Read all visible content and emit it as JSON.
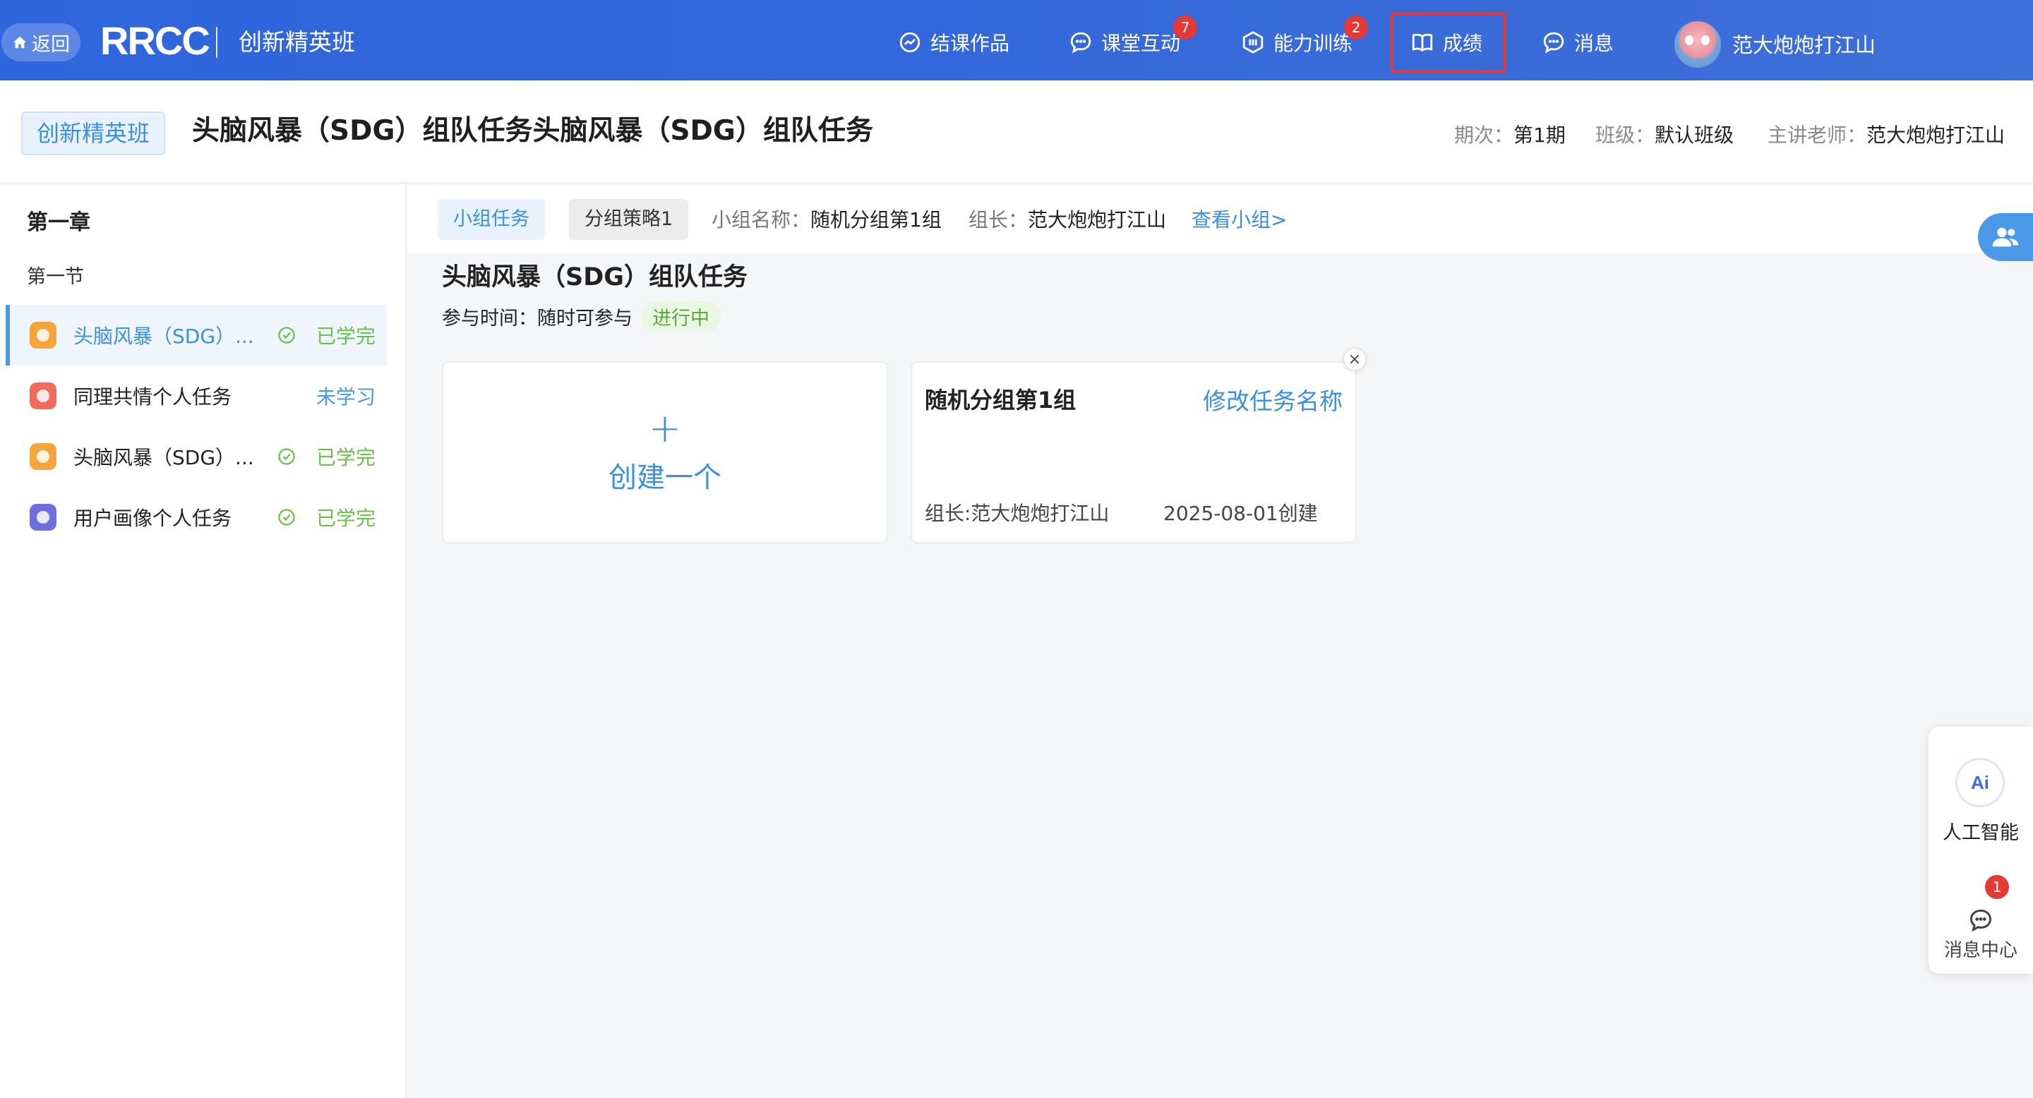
{
  "topbar": {
    "back_label": "返回",
    "logo": "RRCC",
    "brand": "创新精英班",
    "nav": [
      {
        "label": "结课作品",
        "icon": "chart-circle-icon"
      },
      {
        "label": "课堂互动",
        "icon": "chat-bubble-icon",
        "badge": "7"
      },
      {
        "label": "能力训练",
        "icon": "hexagon-icon",
        "badge": "2"
      },
      {
        "label": "成绩",
        "icon": "book-icon",
        "highlighted": true
      },
      {
        "label": "消息",
        "icon": "message-icon"
      }
    ],
    "user_name": "范大炮炮打江山",
    "highlight_color": "#e53935"
  },
  "header": {
    "class_tag": "创新精英班",
    "title": "头脑风暴（SDG）组队任务头脑风暴（SDG）组队任务",
    "period_key": "期次：",
    "period_val": "第1期",
    "class_key": "班级：",
    "class_val": "默认班级",
    "teacher_key": "主讲老师：",
    "teacher_val": "范大炮炮打江山"
  },
  "sidebar": {
    "chapter": "第一章",
    "section": "第一节",
    "lessons": [
      {
        "name": "头脑风暴（SDG）...",
        "status": "已学完",
        "done": true,
        "icon_color": "#f5a53a",
        "active": true
      },
      {
        "name": "同理共情个人任务",
        "status": "未学习",
        "done": false,
        "icon_color": "#f06b5c",
        "active": false
      },
      {
        "name": "头脑风暴（SDG）...",
        "status": "已学完",
        "done": true,
        "icon_color": "#f5a53a",
        "active": false
      },
      {
        "name": "用户画像个人任务",
        "status": "已学完",
        "done": true,
        "icon_color": "#6c6fe0",
        "active": false
      }
    ]
  },
  "filter": {
    "chip_group_task": "小组任务",
    "chip_strategy": "分组策略1",
    "group_name_key": "小组名称：",
    "group_name_val": "随机分组第1组",
    "leader_key": "组长：",
    "leader_val": "范大炮炮打江山",
    "view_group": "查看小组>"
  },
  "task": {
    "title": "头脑风暴（SDG）组队任务",
    "join_key": "参与时间：",
    "join_val": "随时可参与",
    "status": "进行中"
  },
  "cards": {
    "create_plus": "+",
    "create_label": "创建一个",
    "group_name": "随机分组第1组",
    "rename": "修改任务名称",
    "leader": "组长:范大炮炮打江山",
    "created": "2025-08-01创建",
    "close": "×"
  },
  "side_panel": {
    "ai_logo": "Ai",
    "ai_label": "人工智能",
    "msg_badge": "1",
    "msg_label": "消息中心"
  }
}
